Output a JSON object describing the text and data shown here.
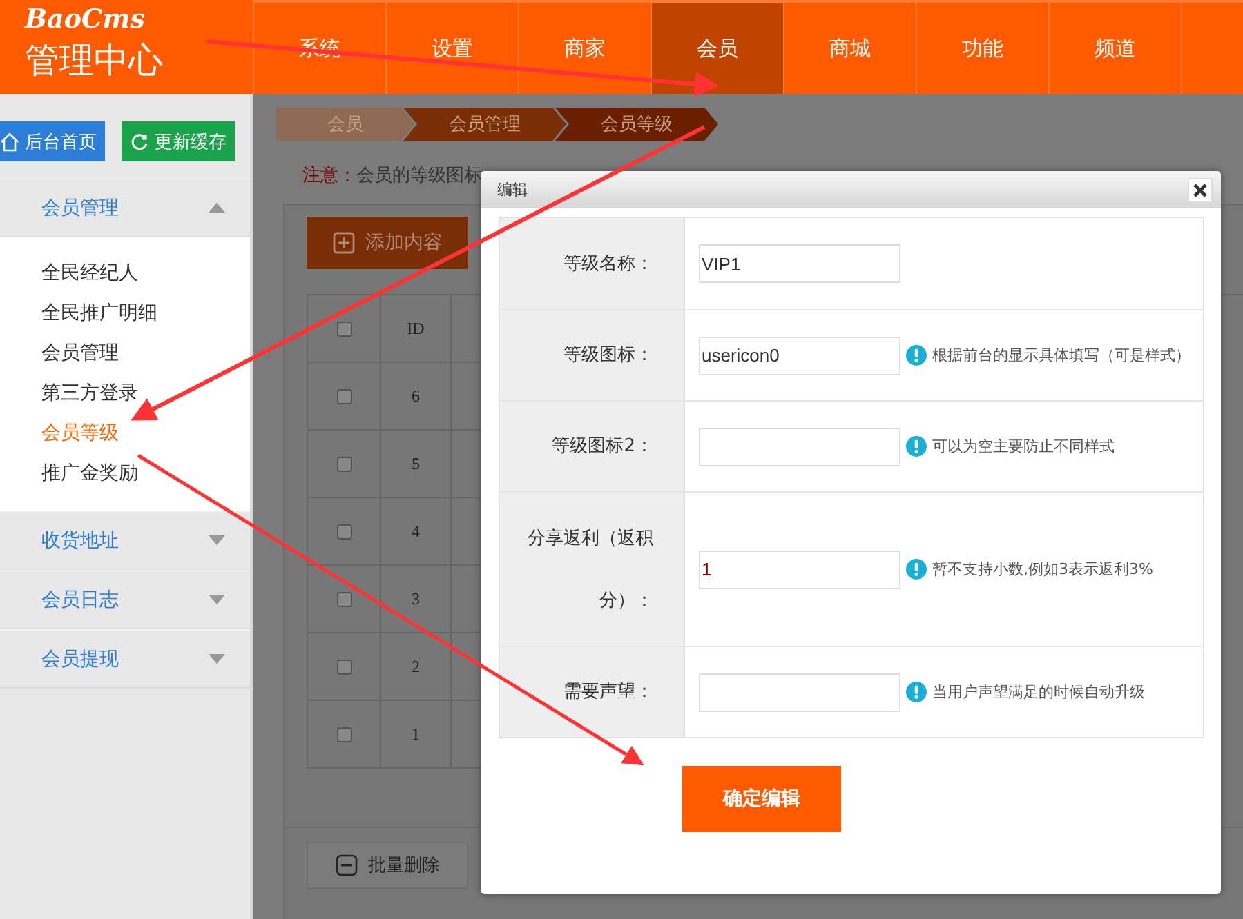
{
  "logo": {
    "brand": "BaoCms",
    "title": "管理中心"
  },
  "nav": [
    {
      "label": "系统",
      "selected": false
    },
    {
      "label": "设置",
      "selected": false
    },
    {
      "label": "商家",
      "selected": false
    },
    {
      "label": "会员",
      "selected": true
    },
    {
      "label": "商城",
      "selected": false
    },
    {
      "label": "功能",
      "selected": false
    },
    {
      "label": "频道",
      "selected": false
    }
  ],
  "sidebar": {
    "buttons": [
      {
        "label": "后台首页",
        "kind": "home"
      },
      {
        "label": "更新缓存",
        "kind": "refresh"
      }
    ],
    "groups": [
      {
        "label": "会员管理",
        "expanded": true,
        "children": [
          {
            "label": "全民经纪人",
            "selected": false
          },
          {
            "label": "全民推广明细",
            "selected": false
          },
          {
            "label": "会员管理",
            "selected": false
          },
          {
            "label": "第三方登录",
            "selected": false
          },
          {
            "label": "会员等级",
            "selected": true
          },
          {
            "label": "推广金奖励",
            "selected": false
          }
        ]
      },
      {
        "label": "收货地址",
        "expanded": false
      },
      {
        "label": "会员日志",
        "expanded": false
      },
      {
        "label": "会员提现",
        "expanded": false
      }
    ]
  },
  "breadcrumb": [
    "会员",
    "会员管理",
    "会员等级"
  ],
  "notice": {
    "label": "注意：",
    "text": "会员的等级图标"
  },
  "add_button": "添加内容",
  "table": {
    "header_checked": false,
    "columns": [
      "ID"
    ],
    "rows": [
      {
        "id": "6",
        "checked": false
      },
      {
        "id": "5",
        "checked": false
      },
      {
        "id": "4",
        "checked": false
      },
      {
        "id": "3",
        "checked": false
      },
      {
        "id": "2",
        "checked": false
      },
      {
        "id": "1",
        "checked": false
      }
    ]
  },
  "batch_delete": "批量删除",
  "dialog": {
    "title": "编辑",
    "fields": [
      {
        "label": "等级名称：",
        "value": "VIP1",
        "tall": false
      },
      {
        "label": "等级图标：",
        "value": "usericon0",
        "hint": "根据前台的显示具体填写（可是样式）",
        "tall": false
      },
      {
        "label": "等级图标2：",
        "hint": "可以为空主要防止不同样式",
        "tall": false
      },
      {
        "label": "分享返利（返积分）：",
        "value": "1",
        "hint": "暂不支持小数,例如3表示返利3%",
        "tall": true
      },
      {
        "label": "需要声望：",
        "hint": "当用户声望满足的时候自动升级",
        "tall": false
      }
    ],
    "submit": "确定编辑"
  }
}
